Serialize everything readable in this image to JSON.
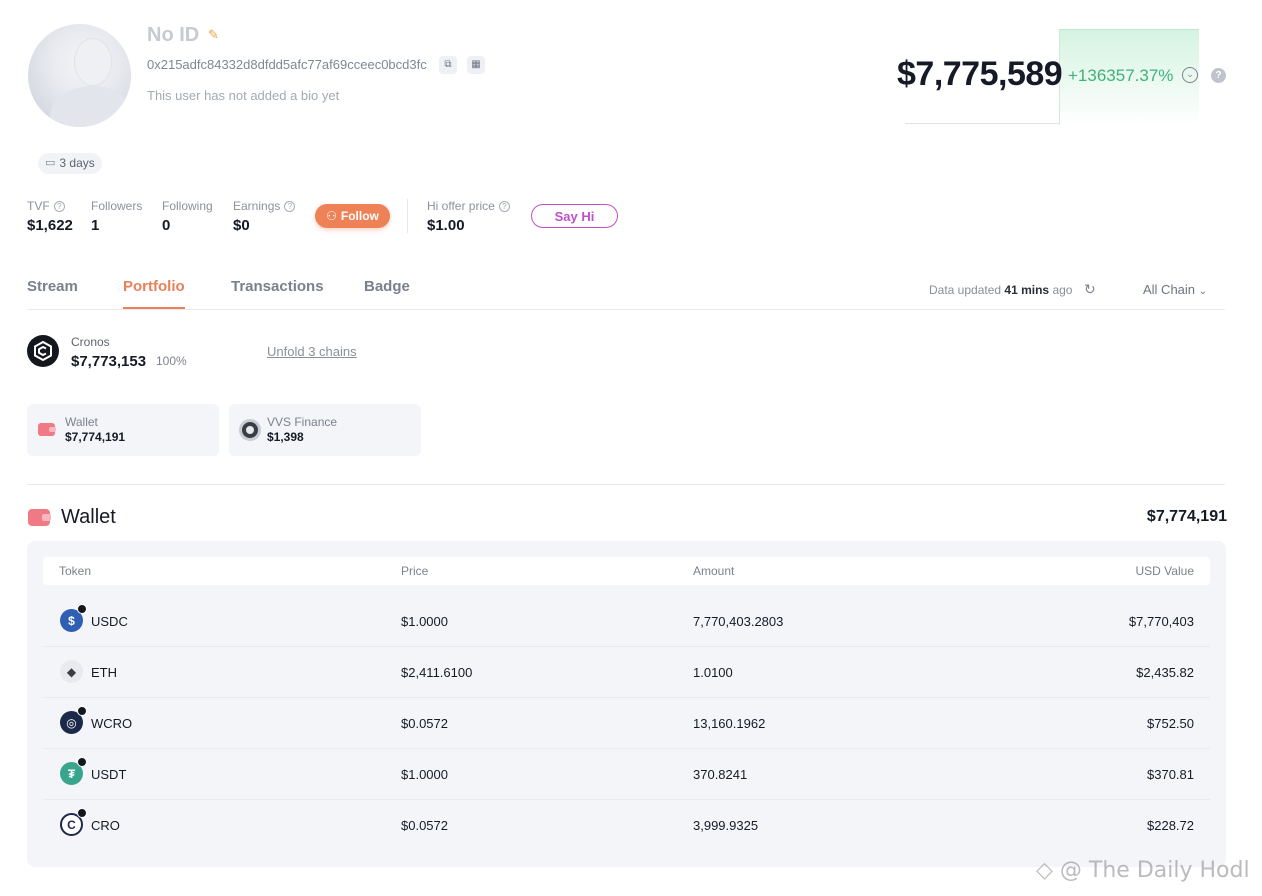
{
  "profile": {
    "name": "No ID",
    "address": "0x215adfc84332d8dfdd5afc77af69cceec0bcd3fc",
    "bio": "This user has not added a bio yet",
    "days_badge": "3 days"
  },
  "net_worth": {
    "value": "$7,775,589",
    "change": "+136357.37%",
    "change_color": "#3fb27a"
  },
  "stats": {
    "tvf": {
      "label": "TVF",
      "value": "$1,622"
    },
    "followers": {
      "label": "Followers",
      "value": "1"
    },
    "following": {
      "label": "Following",
      "value": "0"
    },
    "earnings": {
      "label": "Earnings",
      "value": "$0"
    },
    "follow_button": "Follow",
    "hi_offer": {
      "label": "Hi offer price",
      "value": "$1.00"
    },
    "say_hi_button": "Say Hi"
  },
  "tabs": [
    {
      "label": "Stream"
    },
    {
      "label": "Portfolio"
    },
    {
      "label": "Transactions"
    },
    {
      "label": "Badge"
    }
  ],
  "active_tab": "Portfolio",
  "update_info": {
    "prefix": "Data updated",
    "time": "41 mins",
    "suffix": "ago",
    "chain_filter": "All Chain"
  },
  "chain_summary": {
    "name": "Cronos",
    "value": "$7,773,153",
    "percent": "100%",
    "unfold_link": "Unfold 3 chains"
  },
  "protocols": [
    {
      "name": "Wallet",
      "value": "$7,774,191",
      "icon": "wallet-icon"
    },
    {
      "name": "VVS Finance",
      "value": "$1,398",
      "icon": "vvs-finance-icon"
    }
  ],
  "wallet": {
    "title": "Wallet",
    "total": "$7,774,191",
    "columns": [
      "Token",
      "Price",
      "Amount",
      "USD Value"
    ],
    "rows": [
      {
        "symbol": "USDC",
        "price": "$1.0000",
        "amount": "7,770,403.2803",
        "usd": "$7,770,403",
        "icon_color": "#2f5fb3"
      },
      {
        "symbol": "ETH",
        "price": "$2,411.6100",
        "amount": "1.0100",
        "usd": "$2,435.82",
        "icon_color": "#e9eaee"
      },
      {
        "symbol": "WCRO",
        "price": "$0.0572",
        "amount": "13,160.1962",
        "usd": "$752.50",
        "icon_color": "#1c2a4a"
      },
      {
        "symbol": "USDT",
        "price": "$1.0000",
        "amount": "370.8241",
        "usd": "$370.81",
        "icon_color": "#3aa58d"
      },
      {
        "symbol": "CRO",
        "price": "$0.0572",
        "amount": "3,999.9325",
        "usd": "$228.72",
        "icon_color": "#1c2a4a"
      }
    ]
  },
  "watermark": "@ The Daily Hodl"
}
